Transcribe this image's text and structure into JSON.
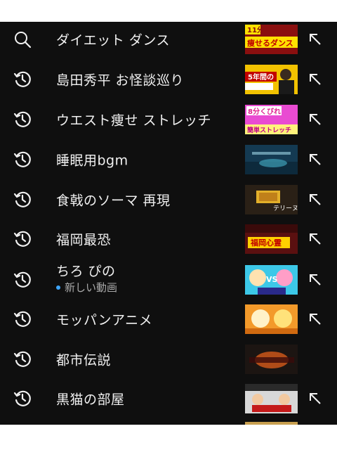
{
  "suggestions": [
    {
      "text": "ダイエット ダンス",
      "kind": "search",
      "thumb_text": "痩せるダンス",
      "thumb_bg": "#8a0f0f",
      "thumb_accent": "#ffe100"
    },
    {
      "text": "島田秀平 お怪談巡り",
      "kind": "history",
      "thumb_text": "5年間の",
      "thumb_bg": "#f2c200",
      "thumb_accent": "#c20000"
    },
    {
      "text": "ウエスト痩せ ストレッチ",
      "kind": "history",
      "thumb_text": "8分くびれ",
      "thumb_bg": "#e94bd2",
      "thumb_accent": "#ffffff"
    },
    {
      "text": "睡眠用bgm",
      "kind": "history",
      "thumb_text": "",
      "thumb_bg": "#143a52",
      "thumb_accent": "#3fa0b7"
    },
    {
      "text": "食戟のソーマ 再現",
      "kind": "history",
      "thumb_text": "テリーヌ",
      "thumb_bg": "#2a2016",
      "thumb_accent": "#e3b02a"
    },
    {
      "text": "福岡最恐",
      "kind": "history",
      "thumb_text": "福岡心霊",
      "thumb_bg": "#5a1010",
      "thumb_accent": "#ffd000"
    },
    {
      "text": "ちろ ぴの",
      "kind": "history",
      "sub": "新しい動画",
      "thumb_text": "VS",
      "thumb_bg": "#3cc8e8",
      "thumb_accent": "#ff9ec7"
    },
    {
      "text": "モッパンアニメ",
      "kind": "history",
      "thumb_text": "",
      "thumb_bg": "#f39a2a",
      "thumb_accent": "#ffe27a"
    },
    {
      "text": "都市伝説",
      "kind": "history",
      "thumb_text": "",
      "thumb_bg": "#1c1512",
      "thumb_accent": "#d65a1a"
    },
    {
      "text": "黒猫の部屋",
      "kind": "history",
      "thumb_text": "",
      "thumb_bg": "#d8d8d8",
      "thumb_accent": "#c41a1a"
    }
  ]
}
